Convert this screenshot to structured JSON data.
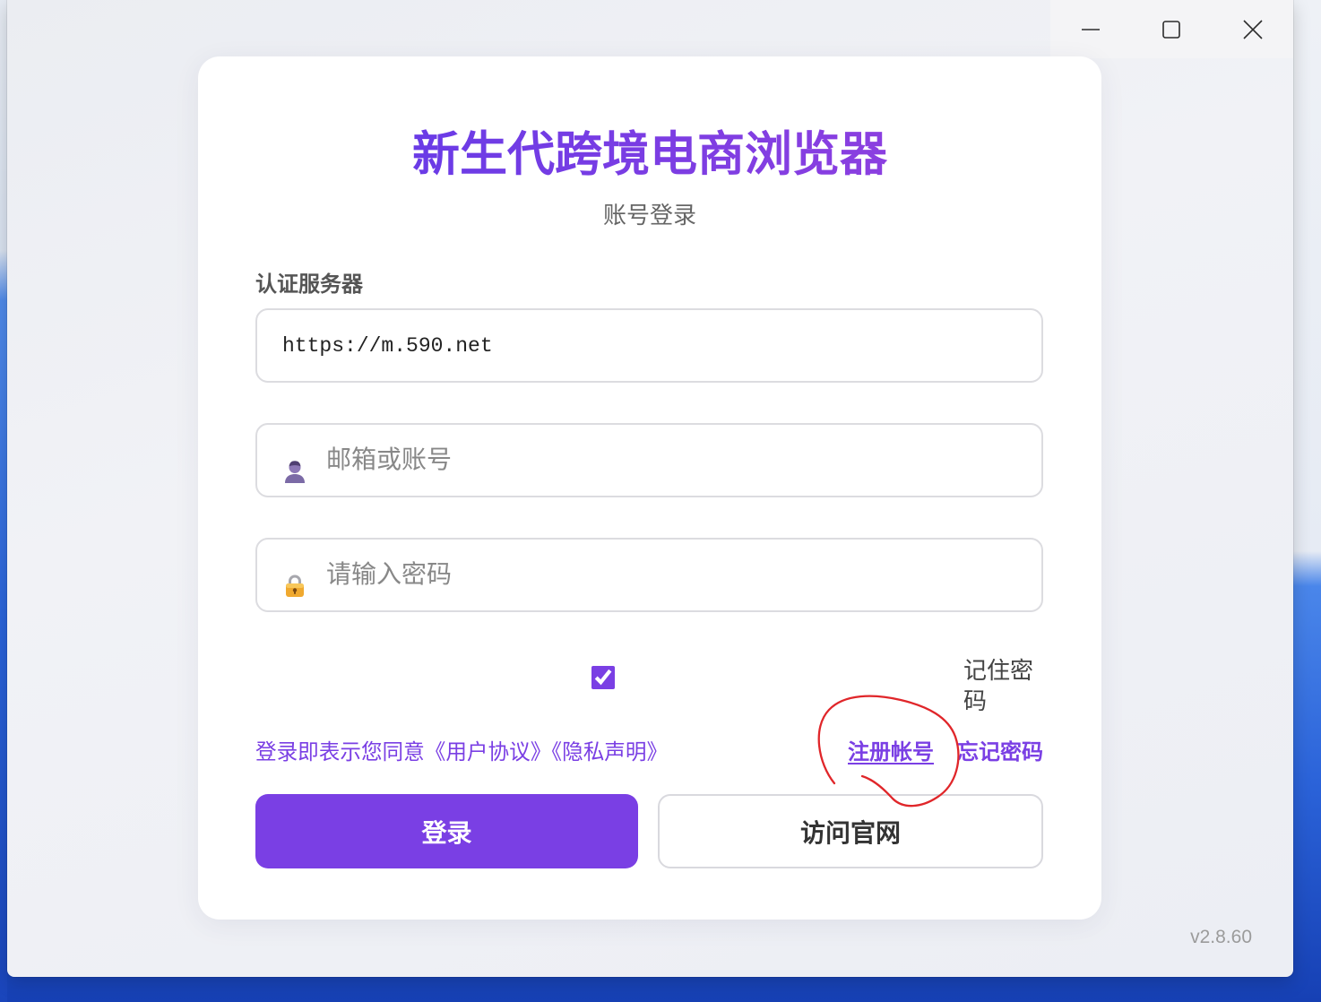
{
  "window": {
    "icons": {
      "minimize": "minimize-icon",
      "maximize": "maximize-icon",
      "close": "close-icon"
    }
  },
  "login": {
    "title": "新生代跨境电商浏览器",
    "subtitle": "账号登录",
    "server": {
      "label": "认证服务器",
      "value": "https://m.590.net"
    },
    "account": {
      "placeholder": "邮箱或账号",
      "icon": "user-icon"
    },
    "password": {
      "placeholder": "请输入密码",
      "icon": "lock-icon"
    },
    "remember": {
      "label": "记住密码",
      "checked": true
    },
    "agreement": {
      "prefix": "登录即表示您同意",
      "user_agreement": "《用户协议》",
      "privacy_statement": "《隐私声明》"
    },
    "links": {
      "register": "注册帐号",
      "forgot_password": "忘记密码"
    },
    "buttons": {
      "login": "登录",
      "visit_website": "访问官网"
    }
  },
  "version": "v2.8.60",
  "colors": {
    "accent": "#7a3fe4",
    "annotation": "#e0262a",
    "title_gradient_start": "#6a3be6",
    "title_gradient_end": "#8b3fe0"
  }
}
